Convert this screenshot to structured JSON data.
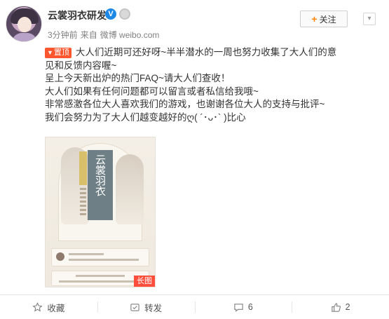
{
  "header": {
    "author_name": "云裳羽衣研发",
    "verified_mark": "V",
    "time": "3分钟前",
    "source_prefix": "来自",
    "source_app": "微博 weibo.com",
    "follow_label": "关注",
    "follow_plus": "+",
    "more_icon": "chevron-down-icon"
  },
  "post": {
    "pin_label": "置顶",
    "pin_glyph": "▼",
    "lines": [
      "大人们近期可还好呀~半半潜水的一周也努力收集了大人们的意见和反馈内容喔~",
      "呈上今天新出炉的热门FAQ~请大人们查收！",
      "大人们如果有任何问题都可以留言或者私信给我哦~",
      "非常感激各位大人喜欢我们的游戏，也谢谢各位大人的支持与批评~",
      "我们会努力为了大人们越变越好的ღ( ´･ᴗ･` )比心"
    ]
  },
  "image": {
    "game_title": "云裳羽衣",
    "badge": "长图"
  },
  "actions": [
    {
      "label": "收藏",
      "icon": "star-icon"
    },
    {
      "label": "转发",
      "icon": "repost-icon"
    },
    {
      "label": "6",
      "icon": "comment-icon"
    },
    {
      "label": "2",
      "icon": "like-icon"
    }
  ],
  "colors": {
    "accent_orange": "#ff8200",
    "pin_red": "#ff5630",
    "verify_blue": "#1e88e5",
    "long_image_badge": "#ff4e3b"
  }
}
